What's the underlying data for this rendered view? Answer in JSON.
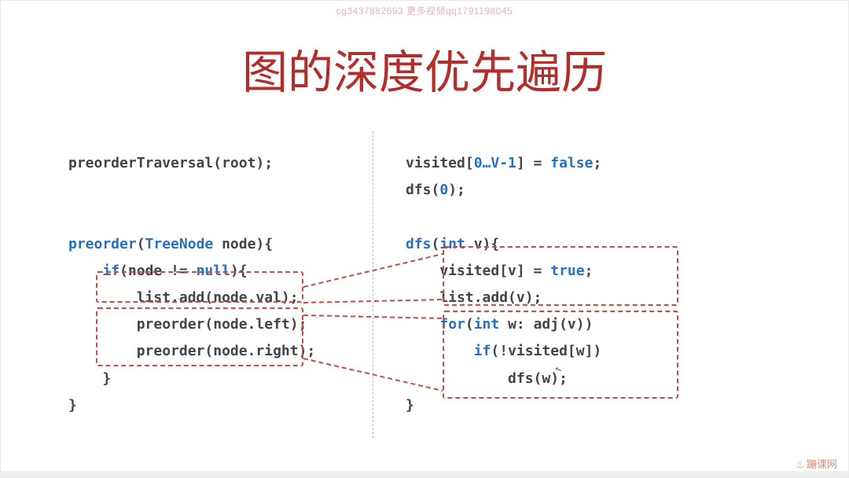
{
  "watermark_top": "cg3437882693 更多视频qq1791198045",
  "title": "图的深度优先遍历",
  "left_code": {
    "l1_a": "preorderTraversal(root);",
    "l2_a": "preorder",
    "l2_b": "(",
    "l2_c": "TreeNode",
    "l2_d": " node){",
    "l3_a": "    ",
    "l3_b": "if",
    "l3_c": "(node != ",
    "l3_d": "null",
    "l3_e": "){",
    "l4_a": "        list.add(node.val);",
    "l5_a": "        preorder(node.left);",
    "l6_a": "        preorder(node.right);",
    "l7_a": "    }",
    "l8_a": "}"
  },
  "right_code": {
    "r1_a": "visited[",
    "r1_b": "0…V-1",
    "r1_c": "] = ",
    "r1_d": "false",
    "r1_e": ";",
    "r2_a": "dfs(",
    "r2_b": "0",
    "r2_c": ");",
    "r3_a": "dfs",
    "r3_b": "(",
    "r3_c": "int",
    "r3_d": " v){",
    "r4_a": "    visited[v] = ",
    "r4_b": "true",
    "r4_c": ";",
    "r5_a": "    list.add(v);",
    "r6_a": "    ",
    "r6_b": "for",
    "r6_c": "(",
    "r6_d": "int",
    "r6_e": " w: adj(v))",
    "r7_a": "        ",
    "r7_b": "if",
    "r7_c": "(!visited[w])",
    "r8_a": "            dfs(w);",
    "r9_a": "}"
  },
  "bottom_right": "蹦课网"
}
